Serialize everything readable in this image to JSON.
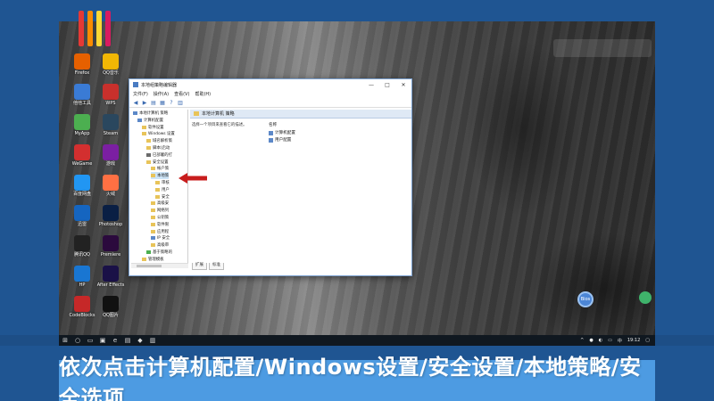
{
  "desktop_icons": [
    {
      "label": "Firefox",
      "color": "#e66000"
    },
    {
      "label": "QQ音乐",
      "color": "#f2b705"
    },
    {
      "label": "他他工具",
      "color": "#3a7bd5"
    },
    {
      "label": "WPS",
      "color": "#c8302c"
    },
    {
      "label": "MyApp",
      "color": "#4caf50"
    },
    {
      "label": "Steam",
      "color": "#2a475e"
    },
    {
      "label": "WeGame",
      "color": "#d32f2f"
    },
    {
      "label": "游戏",
      "color": "#7b1fa2"
    },
    {
      "label": "百度网盘",
      "color": "#2196f3"
    },
    {
      "label": "火绒",
      "color": "#ff7043"
    },
    {
      "label": "迅雷",
      "color": "#1565c0"
    },
    {
      "label": "Photoshop",
      "color": "#0a1f44"
    },
    {
      "label": "腾讯QQ",
      "color": "#222222"
    },
    {
      "label": "Premiere",
      "color": "#2b0a3d"
    },
    {
      "label": "HP",
      "color": "#1976d2"
    },
    {
      "label": "After Effects",
      "color": "#1a1147"
    },
    {
      "label": "CodeBlocks",
      "color": "#c62828"
    },
    {
      "label": "QQ图片",
      "color": "#111111"
    }
  ],
  "window": {
    "title": "本地组策略编辑器",
    "min": "—",
    "max": "□",
    "close": "✕",
    "menu": [
      "文件(F)",
      "操作(A)",
      "查看(V)",
      "帮助(H)"
    ],
    "toolbar_glyphs": [
      "◀",
      "▶",
      "▤",
      "▦",
      "?",
      "▥"
    ],
    "tree": [
      {
        "label": "本地计算机 策略",
        "indent": 0,
        "icon_color": "#5c88c8",
        "selected": false
      },
      {
        "label": "计算机配置",
        "indent": 1,
        "icon_color": "#5c88c8",
        "selected": false
      },
      {
        "label": "软件设置",
        "indent": 2,
        "icon_color": "#e8c45a",
        "selected": false
      },
      {
        "label": "Windows 设置",
        "indent": 2,
        "icon_color": "#e8c45a",
        "selected": false
      },
      {
        "label": "域名解析策",
        "indent": 3,
        "icon_color": "#e8c45a",
        "selected": false
      },
      {
        "label": "脚本(启动",
        "indent": 3,
        "icon_color": "#e8c45a",
        "selected": false
      },
      {
        "label": "已部署的打",
        "indent": 3,
        "icon_color": "#6b6b6b",
        "selected": false
      },
      {
        "label": "安全设置",
        "indent": 3,
        "icon_color": "#e8c45a",
        "selected": false
      },
      {
        "label": "帐户策",
        "indent": 4,
        "icon_color": "#e8c45a",
        "selected": false
      },
      {
        "label": "本地策",
        "indent": 4,
        "icon_color": "#e8c45a",
        "selected": true
      },
      {
        "label": "审核",
        "indent": 5,
        "icon_color": "#e8c45a",
        "selected": false
      },
      {
        "label": "用户",
        "indent": 5,
        "icon_color": "#e8c45a",
        "selected": false
      },
      {
        "label": "安全",
        "indent": 5,
        "icon_color": "#e8c45a",
        "selected": false
      },
      {
        "label": "高级安",
        "indent": 4,
        "icon_color": "#e8c45a",
        "selected": false
      },
      {
        "label": "网络列",
        "indent": 4,
        "icon_color": "#e8c45a",
        "selected": false
      },
      {
        "label": "公钥策",
        "indent": 4,
        "icon_color": "#e8c45a",
        "selected": false
      },
      {
        "label": "软件限",
        "indent": 4,
        "icon_color": "#e8c45a",
        "selected": false
      },
      {
        "label": "应用程",
        "indent": 4,
        "icon_color": "#e8c45a",
        "selected": false
      },
      {
        "label": "IP 安全",
        "indent": 4,
        "icon_color": "#5c88c8",
        "selected": false
      },
      {
        "label": "高级审",
        "indent": 4,
        "icon_color": "#e8c45a",
        "selected": false
      },
      {
        "label": "基于策略的",
        "indent": 3,
        "icon_color": "#4caf50",
        "selected": false
      },
      {
        "label": "管理模板",
        "indent": 2,
        "icon_color": "#e8c45a",
        "selected": false
      }
    ],
    "pane_header": "本地计算机 策略",
    "description": "选择一个项目来查看它的描述。",
    "list_header": "名称",
    "list_items": [
      "计算机配置",
      "用户配置"
    ],
    "tabs": [
      "扩展",
      "标准"
    ]
  },
  "taskbar": {
    "glyphs": [
      "⊞",
      "○",
      "▭",
      "▣",
      "e",
      "▤",
      "◆",
      "▥"
    ],
    "tray": [
      "^",
      "●",
      "◐",
      "▭",
      "中",
      "19:12",
      "▢"
    ]
  },
  "float_ball_label": "Bios",
  "caption": "依次点击计算机配置/Windows设置/安全设置/本地策略/安全选项"
}
